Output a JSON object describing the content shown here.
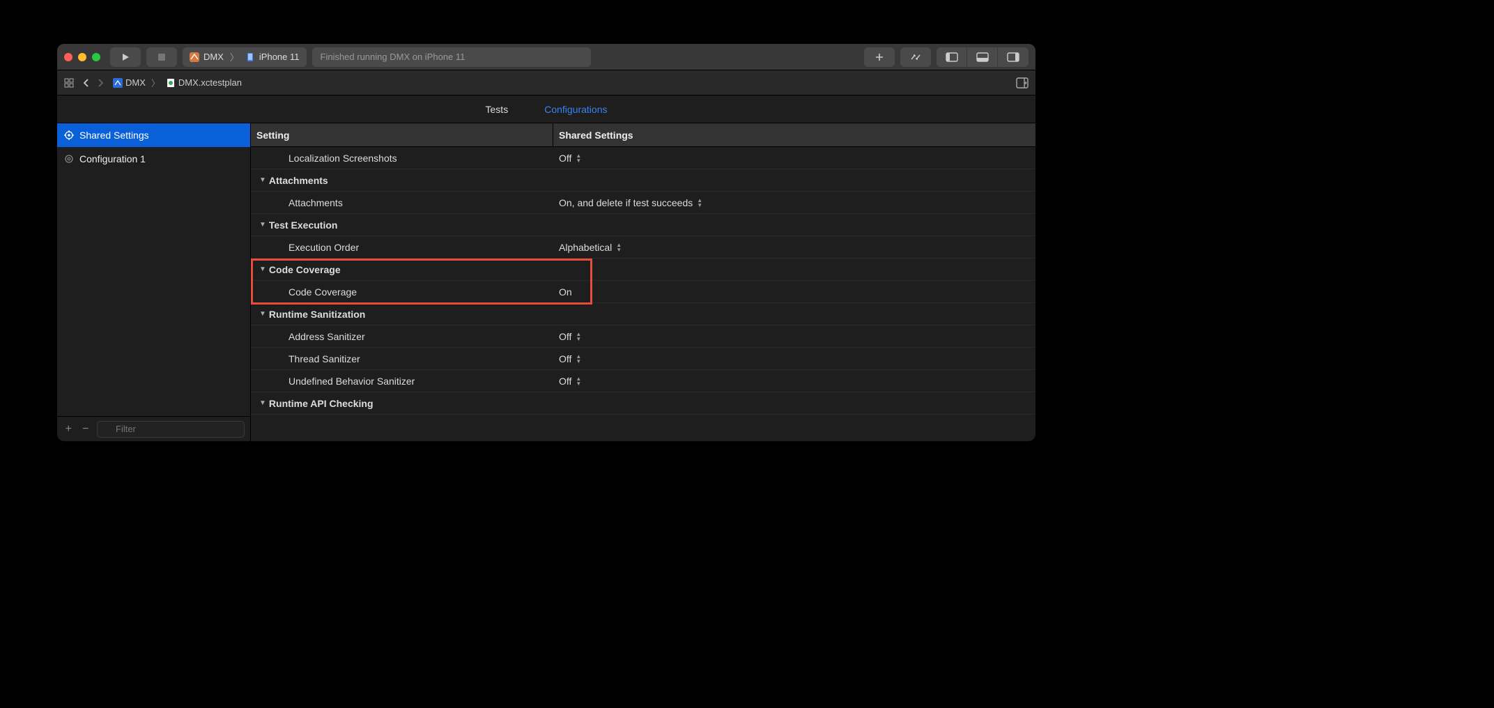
{
  "titlebar": {
    "scheme_app": "DMX",
    "scheme_device": "iPhone 11",
    "status_text": "Finished running DMX on iPhone 11"
  },
  "pathbar": {
    "crumb1": "DMX",
    "crumb2": "DMX.xctestplan"
  },
  "tabs": {
    "tests": "Tests",
    "configs": "Configurations"
  },
  "sidebar": {
    "shared": "Shared Settings",
    "config1": "Configuration 1",
    "filter_placeholder": "Filter"
  },
  "table": {
    "header_setting": "Setting",
    "header_shared": "Shared Settings",
    "rows": {
      "loc_screenshots": "Localization Screenshots",
      "loc_screenshots_val": "Off",
      "grp_attachments": "Attachments",
      "attachments": "Attachments",
      "attachments_val": "On, and delete if test succeeds",
      "grp_test_exec": "Test Execution",
      "exec_order": "Execution Order",
      "exec_order_val": "Alphabetical",
      "grp_code_cov": "Code Coverage",
      "code_cov": "Code Coverage",
      "code_cov_val": "On",
      "grp_runtime_san": "Runtime Sanitization",
      "addr_san": "Address Sanitizer",
      "addr_san_val": "Off",
      "thread_san": "Thread Sanitizer",
      "thread_san_val": "Off",
      "undef_san": "Undefined Behavior Sanitizer",
      "undef_san_val": "Off",
      "grp_runtime_api": "Runtime API Checking"
    }
  }
}
